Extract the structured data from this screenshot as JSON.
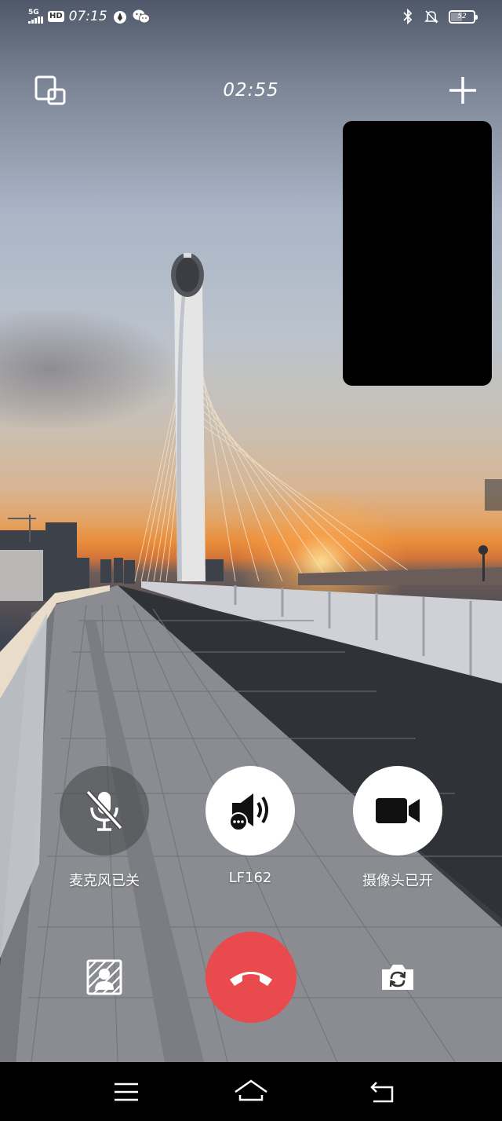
{
  "status_bar": {
    "network": "5G",
    "hd": "HD",
    "time": "07:15",
    "battery": "52",
    "icons": [
      "app-notification-icon",
      "wechat-icon",
      "bluetooth-icon",
      "mute-icon",
      "battery-icon"
    ]
  },
  "call": {
    "timer": "02:55"
  },
  "controls": {
    "mic_label": "麦克风已关",
    "speaker_label": "LF162",
    "camera_label": "摄像头已开"
  },
  "colors": {
    "hangup": "#e84a4d",
    "white_button": "#ffffff",
    "mic_off_button": "#4a4a4c"
  },
  "nav": {
    "icons": [
      "menu-icon",
      "home-icon",
      "back-icon"
    ]
  }
}
